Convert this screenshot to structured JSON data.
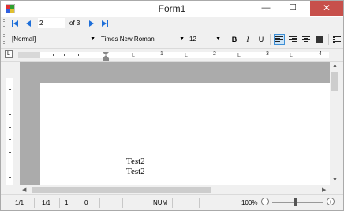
{
  "window": {
    "title": "Form1",
    "minimize_glyph": "—",
    "maximize_glyph": "☐",
    "close_glyph": "✕"
  },
  "navigation": {
    "page_value": "2",
    "of_pages": "of 3",
    "icons": [
      "first-page-icon",
      "previous-page-icon",
      "next-page-icon",
      "last-page-icon"
    ]
  },
  "format": {
    "style": "[Normal]",
    "font_name": "Times New Roman",
    "font_size": "12",
    "bold_label": "B",
    "italic_label": "I",
    "underline_label": "U",
    "align_active": "align-left"
  },
  "ruler": {
    "numbers": [
      "1",
      "2",
      "3",
      "4"
    ]
  },
  "document": {
    "lines": [
      "Test2",
      "Test2"
    ]
  },
  "status": {
    "cell1": "1/1",
    "cell2": "1/1",
    "cell3": "1",
    "cell4": "0",
    "num": "NUM",
    "zoom": "100%",
    "zoom_minus": "−",
    "zoom_plus": "+"
  },
  "colors": {
    "close_button": "#c7504b",
    "nav_arrows": "#1e6fd9",
    "active_button_fill": "#cce4f7",
    "active_button_border": "#3d8fd6",
    "document_background": "#ababab"
  }
}
